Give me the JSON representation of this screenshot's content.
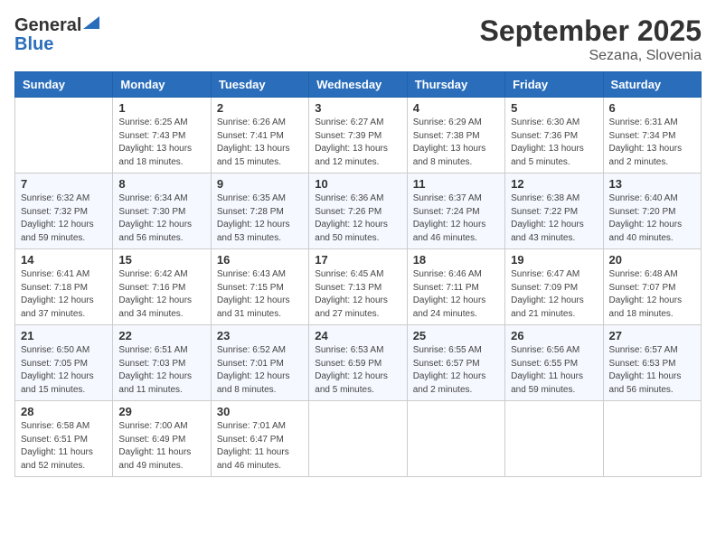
{
  "header": {
    "logo_general": "General",
    "logo_blue": "Blue",
    "title": "September 2025",
    "subtitle": "Sezana, Slovenia"
  },
  "days_of_week": [
    "Sunday",
    "Monday",
    "Tuesday",
    "Wednesday",
    "Thursday",
    "Friday",
    "Saturday"
  ],
  "weeks": [
    [
      {
        "day": "",
        "sunrise": "",
        "sunset": "",
        "daylight": ""
      },
      {
        "day": "1",
        "sunrise": "Sunrise: 6:25 AM",
        "sunset": "Sunset: 7:43 PM",
        "daylight": "Daylight: 13 hours and 18 minutes."
      },
      {
        "day": "2",
        "sunrise": "Sunrise: 6:26 AM",
        "sunset": "Sunset: 7:41 PM",
        "daylight": "Daylight: 13 hours and 15 minutes."
      },
      {
        "day": "3",
        "sunrise": "Sunrise: 6:27 AM",
        "sunset": "Sunset: 7:39 PM",
        "daylight": "Daylight: 13 hours and 12 minutes."
      },
      {
        "day": "4",
        "sunrise": "Sunrise: 6:29 AM",
        "sunset": "Sunset: 7:38 PM",
        "daylight": "Daylight: 13 hours and 8 minutes."
      },
      {
        "day": "5",
        "sunrise": "Sunrise: 6:30 AM",
        "sunset": "Sunset: 7:36 PM",
        "daylight": "Daylight: 13 hours and 5 minutes."
      },
      {
        "day": "6",
        "sunrise": "Sunrise: 6:31 AM",
        "sunset": "Sunset: 7:34 PM",
        "daylight": "Daylight: 13 hours and 2 minutes."
      }
    ],
    [
      {
        "day": "7",
        "sunrise": "Sunrise: 6:32 AM",
        "sunset": "Sunset: 7:32 PM",
        "daylight": "Daylight: 12 hours and 59 minutes."
      },
      {
        "day": "8",
        "sunrise": "Sunrise: 6:34 AM",
        "sunset": "Sunset: 7:30 PM",
        "daylight": "Daylight: 12 hours and 56 minutes."
      },
      {
        "day": "9",
        "sunrise": "Sunrise: 6:35 AM",
        "sunset": "Sunset: 7:28 PM",
        "daylight": "Daylight: 12 hours and 53 minutes."
      },
      {
        "day": "10",
        "sunrise": "Sunrise: 6:36 AM",
        "sunset": "Sunset: 7:26 PM",
        "daylight": "Daylight: 12 hours and 50 minutes."
      },
      {
        "day": "11",
        "sunrise": "Sunrise: 6:37 AM",
        "sunset": "Sunset: 7:24 PM",
        "daylight": "Daylight: 12 hours and 46 minutes."
      },
      {
        "day": "12",
        "sunrise": "Sunrise: 6:38 AM",
        "sunset": "Sunset: 7:22 PM",
        "daylight": "Daylight: 12 hours and 43 minutes."
      },
      {
        "day": "13",
        "sunrise": "Sunrise: 6:40 AM",
        "sunset": "Sunset: 7:20 PM",
        "daylight": "Daylight: 12 hours and 40 minutes."
      }
    ],
    [
      {
        "day": "14",
        "sunrise": "Sunrise: 6:41 AM",
        "sunset": "Sunset: 7:18 PM",
        "daylight": "Daylight: 12 hours and 37 minutes."
      },
      {
        "day": "15",
        "sunrise": "Sunrise: 6:42 AM",
        "sunset": "Sunset: 7:16 PM",
        "daylight": "Daylight: 12 hours and 34 minutes."
      },
      {
        "day": "16",
        "sunrise": "Sunrise: 6:43 AM",
        "sunset": "Sunset: 7:15 PM",
        "daylight": "Daylight: 12 hours and 31 minutes."
      },
      {
        "day": "17",
        "sunrise": "Sunrise: 6:45 AM",
        "sunset": "Sunset: 7:13 PM",
        "daylight": "Daylight: 12 hours and 27 minutes."
      },
      {
        "day": "18",
        "sunrise": "Sunrise: 6:46 AM",
        "sunset": "Sunset: 7:11 PM",
        "daylight": "Daylight: 12 hours and 24 minutes."
      },
      {
        "day": "19",
        "sunrise": "Sunrise: 6:47 AM",
        "sunset": "Sunset: 7:09 PM",
        "daylight": "Daylight: 12 hours and 21 minutes."
      },
      {
        "day": "20",
        "sunrise": "Sunrise: 6:48 AM",
        "sunset": "Sunset: 7:07 PM",
        "daylight": "Daylight: 12 hours and 18 minutes."
      }
    ],
    [
      {
        "day": "21",
        "sunrise": "Sunrise: 6:50 AM",
        "sunset": "Sunset: 7:05 PM",
        "daylight": "Daylight: 12 hours and 15 minutes."
      },
      {
        "day": "22",
        "sunrise": "Sunrise: 6:51 AM",
        "sunset": "Sunset: 7:03 PM",
        "daylight": "Daylight: 12 hours and 11 minutes."
      },
      {
        "day": "23",
        "sunrise": "Sunrise: 6:52 AM",
        "sunset": "Sunset: 7:01 PM",
        "daylight": "Daylight: 12 hours and 8 minutes."
      },
      {
        "day": "24",
        "sunrise": "Sunrise: 6:53 AM",
        "sunset": "Sunset: 6:59 PM",
        "daylight": "Daylight: 12 hours and 5 minutes."
      },
      {
        "day": "25",
        "sunrise": "Sunrise: 6:55 AM",
        "sunset": "Sunset: 6:57 PM",
        "daylight": "Daylight: 12 hours and 2 minutes."
      },
      {
        "day": "26",
        "sunrise": "Sunrise: 6:56 AM",
        "sunset": "Sunset: 6:55 PM",
        "daylight": "Daylight: 11 hours and 59 minutes."
      },
      {
        "day": "27",
        "sunrise": "Sunrise: 6:57 AM",
        "sunset": "Sunset: 6:53 PM",
        "daylight": "Daylight: 11 hours and 56 minutes."
      }
    ],
    [
      {
        "day": "28",
        "sunrise": "Sunrise: 6:58 AM",
        "sunset": "Sunset: 6:51 PM",
        "daylight": "Daylight: 11 hours and 52 minutes."
      },
      {
        "day": "29",
        "sunrise": "Sunrise: 7:00 AM",
        "sunset": "Sunset: 6:49 PM",
        "daylight": "Daylight: 11 hours and 49 minutes."
      },
      {
        "day": "30",
        "sunrise": "Sunrise: 7:01 AM",
        "sunset": "Sunset: 6:47 PM",
        "daylight": "Daylight: 11 hours and 46 minutes."
      },
      {
        "day": "",
        "sunrise": "",
        "sunset": "",
        "daylight": ""
      },
      {
        "day": "",
        "sunrise": "",
        "sunset": "",
        "daylight": ""
      },
      {
        "day": "",
        "sunrise": "",
        "sunset": "",
        "daylight": ""
      },
      {
        "day": "",
        "sunrise": "",
        "sunset": "",
        "daylight": ""
      }
    ]
  ]
}
